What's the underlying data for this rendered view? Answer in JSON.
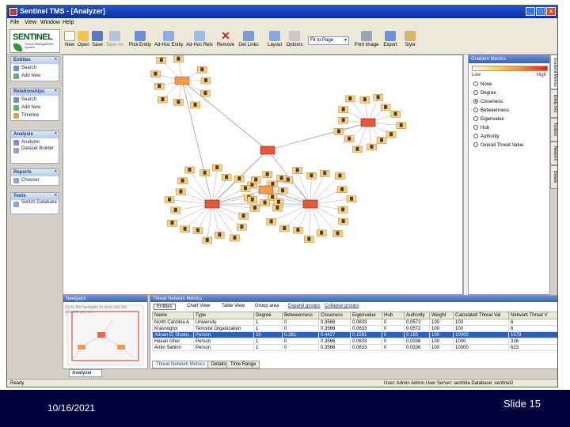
{
  "window": {
    "title": "Sentinel TMS - [Analyzer]",
    "controls": [
      "_",
      "□",
      "×"
    ]
  },
  "menu": [
    "File",
    "View",
    "Window",
    "Help"
  ],
  "logo": {
    "text": "SENTINEL",
    "subtitle": "Threat Management System"
  },
  "toolbar": {
    "buttons": [
      "New",
      "Open",
      "Save",
      "Save As",
      "Pick Entity",
      "Ad-Hoc Entity",
      "Ad-Hoc Rels",
      "Remove",
      "Get Links",
      "Layout",
      "Options"
    ],
    "combo_value": "Fit to Page",
    "buttons_right": [
      "Print Image",
      "Export",
      "Style"
    ]
  },
  "sidebar": {
    "sections": [
      {
        "header": "Entities",
        "items": [
          "Search",
          "Add New"
        ]
      },
      {
        "header": "Relationships",
        "items": [
          "Search",
          "Add New",
          "Timeline"
        ]
      },
      {
        "header": "Analysis",
        "items": [
          "Analyzer",
          "Dataset Builder"
        ]
      },
      {
        "header": "Reports",
        "items": [
          "Chooser"
        ]
      },
      {
        "header": "Tools",
        "items": [
          "Switch Database"
        ]
      }
    ]
  },
  "gradient_metrics": {
    "header": "Gradient Metrics",
    "low": "Low",
    "high": "High",
    "options": [
      "None",
      "Degree",
      "Closeness",
      "Betweenness",
      "Eigenvalue",
      "Hub",
      "Authority",
      "Overall Threat Value"
    ],
    "selected": "Closeness"
  },
  "vertical_tabs": [
    "Gradient Metrics",
    "Entity Info",
    "Toolbox",
    "Network",
    "Details"
  ],
  "navigator": {
    "header": "Navigator",
    "text": "Go to the navigator to view only the network you see."
  },
  "threat_panel": {
    "header": "Threat Network Metrics",
    "view_options": [
      "Entities",
      "Chart View",
      "Table View"
    ],
    "group_area": "Group area",
    "expand": "Expand groups",
    "collapse": "Collapse groups",
    "columns": [
      "Name",
      "Type",
      "Degree",
      "Betweenness",
      "Closeness",
      "Eigenvalue",
      "Hub",
      "Authority",
      "Weight",
      "Calculated Threat Val",
      "Network Threat V"
    ],
    "rows": [
      [
        "North Carolina A",
        "University",
        "1",
        "0",
        "0.3566",
        "0.0633",
        "0",
        "0.0572",
        "100",
        "100",
        "6"
      ],
      [
        "Krasnogrpr",
        "Terrorist Organization",
        "1",
        "0",
        "0.3566",
        "0.0633",
        "0",
        "0.0572",
        "100",
        "100",
        "6"
      ],
      [
        "Adnan El Shukri...",
        "Person",
        "20",
        "0.381",
        "0.4427",
        "0.1591",
        "0",
        "0.165",
        "100",
        "10000",
        "1578"
      ],
      [
        "Hasan Ghul",
        "Person",
        "1",
        "0",
        "0.3566",
        "0.0633",
        "0",
        "0.0336",
        "100",
        "1000",
        "316"
      ],
      [
        "Amin Sahimi",
        "Person",
        "1",
        "0",
        "0.3566",
        "0.0633",
        "0",
        "0.0336",
        "100",
        "10000",
        "623"
      ]
    ],
    "selected_row": 2,
    "tabs": [
      "Threat Network Metrics",
      "Details",
      "Time Range"
    ]
  },
  "doc_tab": "Analyzer",
  "status": {
    "left": "Ready",
    "right": "User: Admin  Admin User  Server: sentinla  Database: sentinel2"
  },
  "slide": {
    "date": "10/16/2021",
    "number": "Slide 15"
  }
}
